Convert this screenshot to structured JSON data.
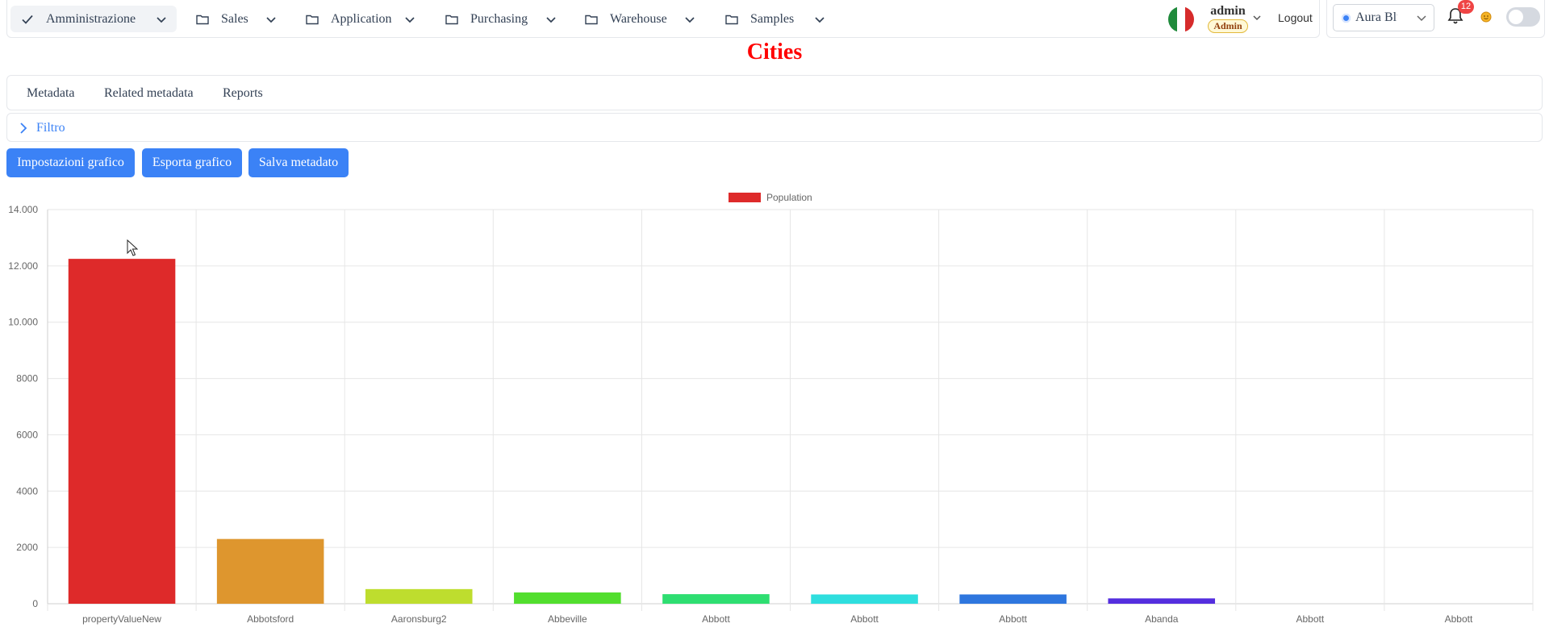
{
  "nav": {
    "items": [
      {
        "label": "Amministrazione",
        "icon": "check-icon",
        "active": true
      },
      {
        "label": "Sales",
        "icon": "folder-icon"
      },
      {
        "label": "Application",
        "icon": "folder-icon"
      },
      {
        "label": "Purchasing",
        "icon": "folder-icon"
      },
      {
        "label": "Warehouse",
        "icon": "folder-icon"
      },
      {
        "label": "Samples",
        "icon": "folder-icon"
      }
    ],
    "user": {
      "name": "admin",
      "role": "Admin"
    },
    "logout_label": "Logout",
    "theme_label": "Aura Blue",
    "notification_count": "12"
  },
  "page": {
    "title": "Cities"
  },
  "tabs": [
    "Metadata",
    "Related metadata",
    "Reports"
  ],
  "filter": {
    "label": "Filtro"
  },
  "buttons": {
    "settings": "Impostazioni grafico",
    "export": "Esporta grafico",
    "save": "Salva metadato"
  },
  "colors": {
    "primary": "#3b82f6",
    "title": "#ff0000",
    "bars": [
      "#de2a2a",
      "#de962e",
      "#bedd2e",
      "#52de2e",
      "#2ede71",
      "#2edede",
      "#2e76de",
      "#542ede",
      "#a62ede",
      "#de2ede"
    ]
  },
  "chart_data": {
    "type": "bar",
    "categories": [
      "propertyValueNew",
      "Abbotsford",
      "Aaronsburg2",
      "Abbeville",
      "Abbott",
      "Abbott",
      "Abbott",
      "Abanda",
      "Abbott",
      "Abbott"
    ],
    "series": [
      {
        "name": "Population",
        "values": [
          12250,
          2300,
          520,
          400,
          340,
          330,
          330,
          190,
          0,
          0
        ]
      }
    ],
    "ylim": [
      0,
      14000
    ],
    "yticks": [
      0,
      2000,
      4000,
      6000,
      8000,
      10000,
      12000,
      14000
    ],
    "ytick_labels": [
      "0",
      "2000",
      "4000",
      "6000",
      "8000",
      "10.000",
      "12.000",
      "14.000"
    ],
    "legend": "top-center",
    "grid": true
  }
}
